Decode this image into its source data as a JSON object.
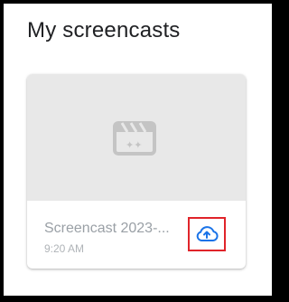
{
  "page": {
    "title": "My screencasts"
  },
  "screencasts": [
    {
      "title": "Screencast 2023-...",
      "time": "9:20 AM",
      "thumbnail_icon": "movie-clapperboard-icon",
      "action_icon": "cloud-upload-icon"
    }
  ],
  "colors": {
    "title_text": "#202124",
    "card_text": "#9aa0a6",
    "thumbnail_bg": "#e8e8e8",
    "upload_icon": "#1a73e8",
    "highlight_border": "#e0242a"
  }
}
